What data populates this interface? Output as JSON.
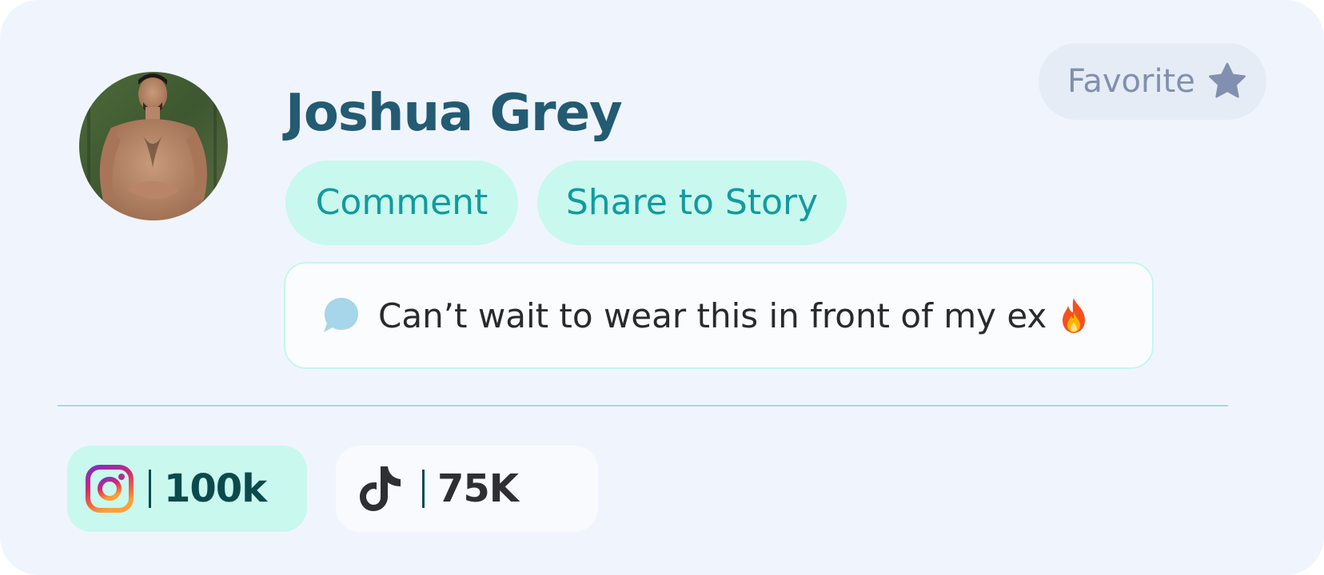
{
  "profile": {
    "name": "Joshua Grey"
  },
  "favorite": {
    "label": "Favorite",
    "icon": "star-icon",
    "color": "#8190AE"
  },
  "actions": [
    {
      "label": "Comment"
    },
    {
      "label": "Share to Story"
    }
  ],
  "comment": {
    "icon": "chat-bubble-icon",
    "text": "Can’t wait to wear this in front of my ex",
    "emoji": "fire-emoji-icon"
  },
  "stats": [
    {
      "platform": "instagram-icon",
      "value": "100k",
      "background": "#C9F8EE"
    },
    {
      "platform": "tiktok-icon",
      "value": "75K",
      "background": "#F8FAFE"
    }
  ],
  "colors": {
    "card_background": "#F0F5FD",
    "name": "#235B73",
    "action_background": "#C9F8EE",
    "action_text": "#119BA0",
    "divider": "#A8D7EA"
  }
}
